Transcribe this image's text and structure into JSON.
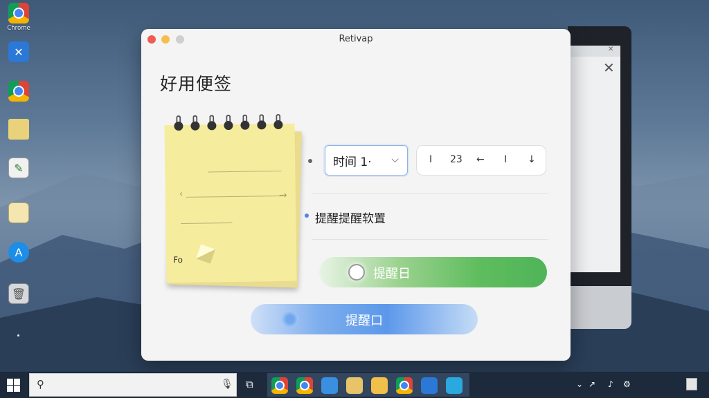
{
  "desktop": {
    "icons": [
      {
        "name": "chrome-icon",
        "label": "Chrome"
      },
      {
        "name": "app-icon",
        "label": ""
      },
      {
        "name": "chrome-icon",
        "label": ""
      },
      {
        "name": "folder-icon",
        "label": ""
      },
      {
        "name": "file-icon",
        "label": ""
      },
      {
        "name": "notes-icon",
        "label": ""
      },
      {
        "name": "app-store-icon",
        "label": ""
      },
      {
        "name": "recycle-bin-icon",
        "label": ""
      }
    ]
  },
  "window": {
    "title": "Retivap",
    "heading": "好用便签"
  },
  "notepad": {
    "text": "",
    "corner_text": "Fo"
  },
  "controls": {
    "time_select": "时间 1·",
    "time_picker": {
      "hour": "I",
      "minute": "23",
      "back": "←",
      "sep": "I",
      "down": "↓"
    },
    "setting_label": "提醒提醒软置",
    "green_button_label": "提醒日",
    "blue_button_label": "提醒口"
  },
  "taskbar": {
    "search_placeholder": "",
    "clock_line1": "",
    "clock_line2": ""
  },
  "colors": {
    "green_accent": "#5fbd5e",
    "blue_accent": "#5c98ea",
    "select_border": "#8db1e8"
  }
}
